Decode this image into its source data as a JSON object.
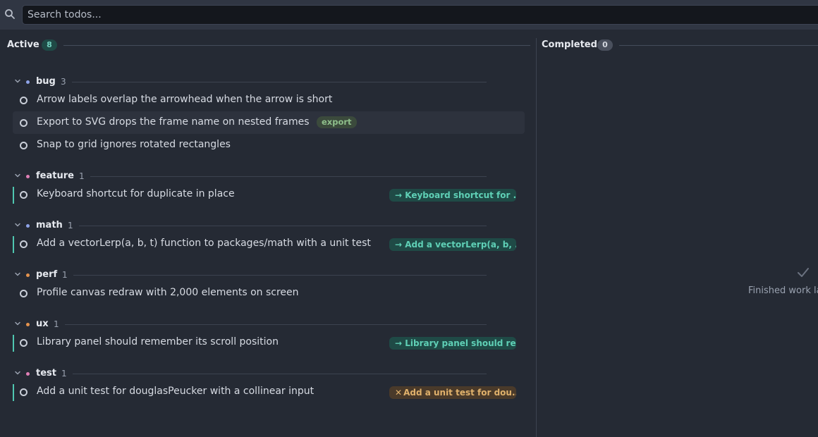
{
  "search": {
    "placeholder": "Search todos..."
  },
  "columns": {
    "active": {
      "title": "Active",
      "count": "8"
    },
    "completed": {
      "title": "Completed",
      "count": "0",
      "empty_message": "Finished work la"
    }
  },
  "groups": [
    {
      "name": "bug",
      "count": "3",
      "dot_color": "#8ea3e8",
      "items": [
        {
          "text": "Arrow labels overlap the arrowhead when the arrow is short"
        },
        {
          "text": "Export to SVG drops the frame name on nested frames",
          "tag": "export"
        },
        {
          "text": "Snap to grid ignores rotated rectangles"
        }
      ]
    },
    {
      "name": "feature",
      "count": "1",
      "dot_color": "#e07fb6",
      "items": [
        {
          "text": "Keyboard shortcut for duplicate in place",
          "link": "→ Keyboard shortcut for ..."
        }
      ]
    },
    {
      "name": "math",
      "count": "1",
      "dot_color": "#8ea3e8",
      "items": [
        {
          "text": "Add a vectorLerp(a, b, t) function to packages/math with a unit test",
          "link": "→ Add a vectorLerp(a, b, ..."
        }
      ]
    },
    {
      "name": "perf",
      "count": "1",
      "dot_color": "#e5934d",
      "items": [
        {
          "text": "Profile canvas redraw with 2,000 elements on screen"
        }
      ]
    },
    {
      "name": "ux",
      "count": "1",
      "dot_color": "#e5934d",
      "items": [
        {
          "text": "Library panel should remember its scroll position",
          "link": "→ Library panel should re..."
        }
      ]
    },
    {
      "name": "test",
      "count": "1",
      "dot_color": "#e07fb6",
      "items": [
        {
          "text": "Add a unit test for douglasPeucker with a collinear input",
          "link": "Add a unit test for dou...",
          "link_status": "error"
        }
      ]
    }
  ]
}
